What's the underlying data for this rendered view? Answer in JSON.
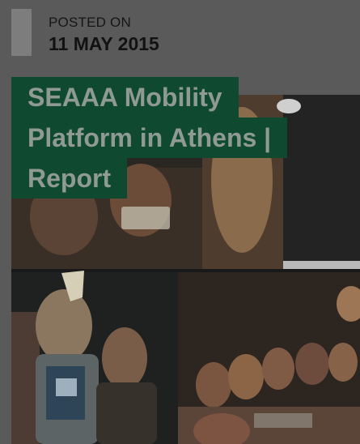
{
  "post": {
    "posted_label": "POSTED ON",
    "date": "11 MAY 2015",
    "title_lines": [
      "SEAAA Mobility",
      "Platform in Athens |",
      "Report"
    ]
  },
  "colors": {
    "page_background": "#5a5a5a",
    "date_marker": "#7d7d7d",
    "title_background": "#0f4a30",
    "title_text": "#8f9a94"
  },
  "icons": {
    "date_marker": "date-marker-bar"
  }
}
